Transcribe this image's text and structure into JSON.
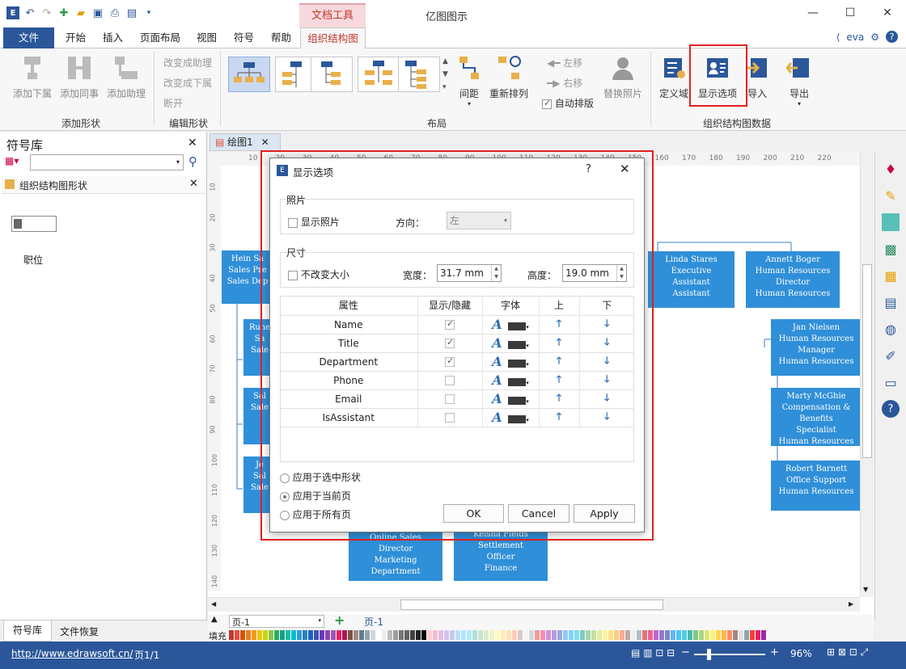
{
  "app": {
    "title": "亿图图示",
    "context_tab": "文档工具",
    "user": "eva"
  },
  "menu": {
    "tabs": [
      "文件",
      "开始",
      "插入",
      "页面布局",
      "视图",
      "符号",
      "帮助",
      "组织结构图"
    ]
  },
  "ribbon": {
    "add_group": {
      "label": "添加形状",
      "buttons": [
        "添加下属",
        "添加同事",
        "添加助理"
      ]
    },
    "edit_group": {
      "label": "编辑形状",
      "buttons": [
        "改变成助理",
        "改变成下属",
        "断开"
      ]
    },
    "layout_group": {
      "label": "布局",
      "spacing": "间距",
      "rearrange": "重新排列",
      "left": "左移",
      "right": "右移",
      "auto": "自动排版",
      "replace_photo": "替换照片"
    },
    "data_group": {
      "label": "组织结构图数据",
      "define": "定义域",
      "display": "显示选项",
      "import": "导入",
      "export": "导出"
    }
  },
  "symbol_library": {
    "title": "符号库",
    "section": "组织结构图形状",
    "item_label": "职位",
    "bottom_tabs": [
      "符号库",
      "文件恢复"
    ]
  },
  "canvas": {
    "doc_tab": "绘图1",
    "ruler_ticks": [
      "10",
      "20",
      "30",
      "40",
      "50",
      "60",
      "70",
      "80",
      "90",
      "100",
      "110",
      "120",
      "130",
      "140",
      "150",
      "160",
      "170",
      "180",
      "190",
      "200",
      "210",
      "220"
    ],
    "vruler_ticks": [
      "10",
      "20",
      "30",
      "40",
      "50",
      "60",
      "70",
      "80",
      "90",
      "100",
      "110",
      "120",
      "130",
      "140"
    ],
    "boxes": [
      {
        "lines": [
          "Hein Sa",
          "Sales Pre",
          "Sales Dep"
        ]
      },
      {
        "lines": [
          "Rune",
          "Sa",
          "Sale"
        ]
      },
      {
        "lines": [
          "Sal",
          "Sale"
        ]
      },
      {
        "lines": [
          "Je",
          "Sal",
          "Sale"
        ]
      },
      {
        "lines": [
          "Linda Stares",
          "Executive",
          "Assistant",
          "Assistant"
        ]
      },
      {
        "lines": [
          "Annett Boger",
          "Human Resources",
          "Director",
          "Human Resources"
        ]
      },
      {
        "lines": [
          "Jan Nielsen",
          "Human Resources",
          "Manager",
          "Human Resources"
        ]
      },
      {
        "lines": [
          "Marty McGhie",
          "Compensation &",
          "Benefits",
          "Specialist",
          "Human Resources"
        ]
      },
      {
        "lines": [
          "Robert Barnett",
          "Office Support",
          "Human Resources"
        ]
      },
      {
        "lines": [
          "Online Sales",
          "Director",
          "Marketing",
          "Department"
        ]
      },
      {
        "lines": [
          "Keisha Fields",
          "Settlement",
          "Officer",
          "Finance"
        ]
      }
    ]
  },
  "pages": {
    "current": "页-1",
    "active_tab": "页-1",
    "fill_label": "填充"
  },
  "status": {
    "url": "http://www.edrawsoft.cn/",
    "page": "页1/1",
    "zoom": "96%"
  },
  "dialog": {
    "title": "显示选项",
    "help": "?",
    "photo_section": "照片",
    "show_photo": "显示照片",
    "direction_label": "方向：",
    "direction_value": "左",
    "size_section": "尺寸",
    "keep_size": "不改变大小",
    "width_label": "宽度：",
    "width_value": "31.7 mm",
    "height_label": "高度：",
    "height_value": "19.0 mm",
    "columns": [
      "属性",
      "显示/隐藏",
      "字体",
      "上",
      "下"
    ],
    "rows": [
      {
        "name": "Name",
        "shown": true
      },
      {
        "name": "Title",
        "shown": true
      },
      {
        "name": "Department",
        "shown": true
      },
      {
        "name": "Phone",
        "shown": false
      },
      {
        "name": "Email",
        "shown": false
      },
      {
        "name": "IsAssistant",
        "shown": false
      }
    ],
    "apply_options": [
      "应用于选中形状",
      "应用于当前页",
      "应用于所有页"
    ],
    "selected_apply": 1,
    "ok": "OK",
    "cancel": "Cancel",
    "apply": "Apply"
  },
  "colors": {
    "accent": "#2b579a",
    "shape": "#2f8fd8",
    "highlight": "#e02020"
  }
}
